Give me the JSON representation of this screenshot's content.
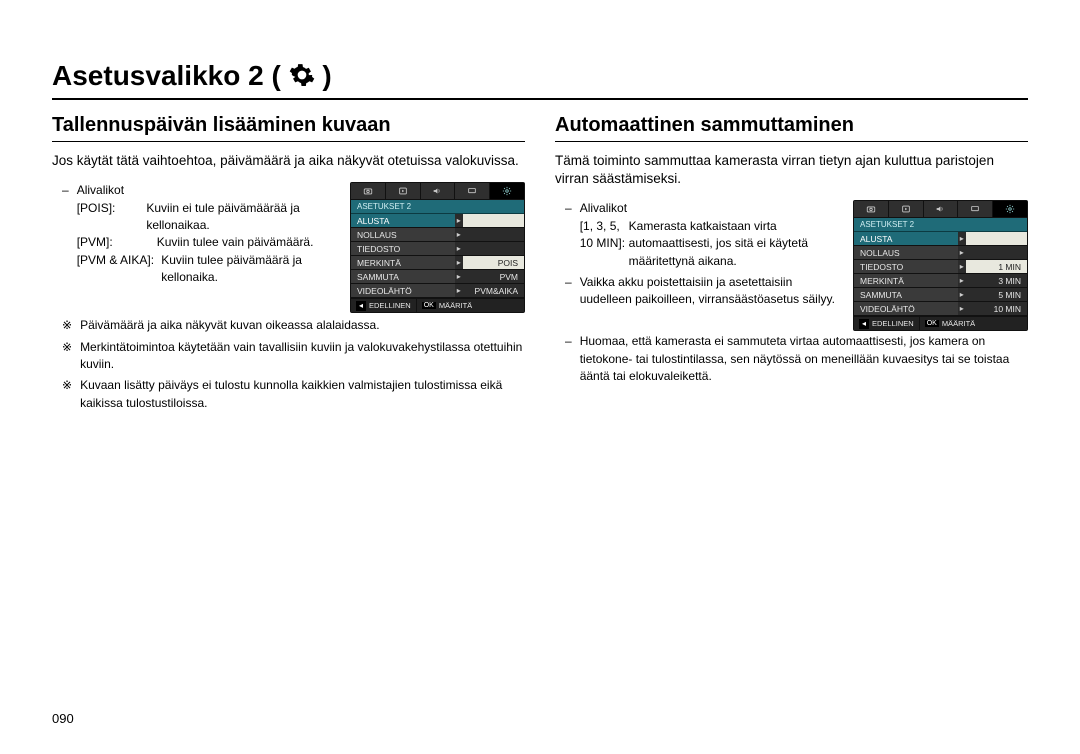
{
  "title": "Asetusvalikko 2 (",
  "title_close": ")",
  "left": {
    "heading": "Tallennuspäivän lisääminen kuvaan",
    "intro": "Jos käytät tätä vaihtoehtoa, päivämäärä ja aika näkyvät otetuissa valokuvissa.",
    "submenu_label": "Alivalikot",
    "options": [
      {
        "label": "[POIS]:",
        "desc": "Kuviin ei tule päivämäärää ja kellonaikaa."
      },
      {
        "label": "[PVM]:",
        "desc": "Kuviin tulee vain päivämäärä."
      },
      {
        "label": "[PVM & AIKA]:",
        "desc": "Kuviin tulee päivämäärä ja kellonaika."
      }
    ],
    "notes": [
      "Päivämäärä ja aika näkyvät kuvan oikeassa alalaidassa.",
      "Merkintätoimintoa käytetään vain tavallisiin kuviin ja valokuvakehystilassa otettuihin kuviin.",
      "Kuvaan lisätty päiväys ei tulostu kunnolla kaikkien valmistajien tulostimissa eikä kaikissa tulostustiloissa."
    ],
    "lcd": {
      "header": "ASETUKSET 2",
      "rows": [
        {
          "l": "ALUSTA",
          "r": "",
          "chev": true,
          "sel": true
        },
        {
          "l": "NOLLAUS",
          "r": "",
          "chev": true
        },
        {
          "l": "TIEDOSTO",
          "r": "",
          "chev": true
        },
        {
          "l": "MERKINTÄ",
          "r": "POIS",
          "chev": true,
          "selR": true
        },
        {
          "l": "SAMMUTA",
          "r": "PVM",
          "chev": true
        },
        {
          "l": "VIDEOLÄHTÖ",
          "r": "PVM&AIKA",
          "chev": true
        }
      ],
      "footer_prev": "EDELLINEN",
      "footer_ok": "OK",
      "footer_set": "MÄÄRITÄ"
    }
  },
  "right": {
    "heading": "Automaattinen sammuttaminen",
    "intro": "Tämä toiminto sammuttaa kamerasta virran tietyn ajan kuluttua paristojen virran säästämiseksi.",
    "submenu_label": "Alivalikot",
    "option_label": "[1, 3, 5, 10 MIN]:",
    "option_desc": "Kamerasta katkaistaan virta automaattisesti, jos sitä ei käytetä määritettynä aikana.",
    "bullets": [
      "Vaikka akku poistettaisiin ja asetettaisiin uudelleen paikoilleen, virransäästöasetus säilyy.",
      "Huomaa, että kamerasta ei sammuteta virtaa automaattisesti, jos kamera on tietokone- tai tulostintilassa, sen näytössä on meneillään kuvaesitys tai se toistaa ääntä tai elokuvaleikettä."
    ],
    "lcd": {
      "header": "ASETUKSET 2",
      "rows": [
        {
          "l": "ALUSTA",
          "r": "",
          "chev": true,
          "sel": true
        },
        {
          "l": "NOLLAUS",
          "r": "",
          "chev": true
        },
        {
          "l": "TIEDOSTO",
          "r": "1 MIN",
          "chev": true,
          "selR": true
        },
        {
          "l": "MERKINTÄ",
          "r": "3 MIN",
          "chev": true
        },
        {
          "l": "SAMMUTA",
          "r": "5 MIN",
          "chev": true
        },
        {
          "l": "VIDEOLÄHTÖ",
          "r": "10 MIN",
          "chev": true
        }
      ],
      "footer_prev": "EDELLINEN",
      "footer_ok": "OK",
      "footer_set": "MÄÄRITÄ"
    }
  },
  "page_number": "090"
}
